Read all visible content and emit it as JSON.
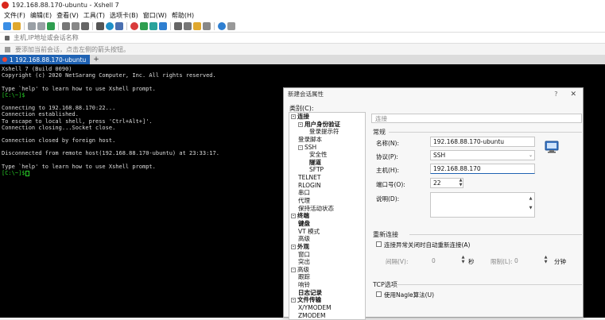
{
  "window": {
    "title": "192.168.88.170-ubuntu - Xshell 7"
  },
  "menu": [
    "文件(F)",
    "编辑(E)",
    "查看(V)",
    "工具(T)",
    "选项卡(B)",
    "窗口(W)",
    "帮助(H)"
  ],
  "address": {
    "placeholder": "主机,IP地址或会话名称"
  },
  "hint": {
    "text": "要添加当前会话，点击左侧的箭头按钮。"
  },
  "tab": {
    "label": "1 192.168.88.170-ubuntu",
    "add": "+"
  },
  "terminal": {
    "lines": [
      "Xshell 7 (Build 0090)",
      "Copyright (c) 2020 NetSarang Computer, Inc. All rights reserved.",
      "",
      "Type `help' to learn how to use Xshell prompt.",
      "[C:\\~]$",
      "",
      "Connecting to 192.168.88.170:22...",
      "Connection established.",
      "To escape to local shell, press 'Ctrl+Alt+]'.",
      "Connection closing...Socket close.",
      "",
      "Connection closed by foreign host.",
      "",
      "Disconnected from remote host(192.168.88.170-ubuntu) at 23:33:17.",
      "",
      "Type `help' to learn how to use Xshell prompt.",
      "[C:\\~]$"
    ]
  },
  "dialog": {
    "title": "新建会话属性",
    "help": "?",
    "close": "✕",
    "category_label": "类别(C):",
    "tree": [
      {
        "label": "连接",
        "level": "l0",
        "toggle": "-"
      },
      {
        "label": "用户身份验证",
        "level": "l1b",
        "toggle": "-"
      },
      {
        "label": "登录提示符",
        "level": "l2",
        "toggle": ""
      },
      {
        "label": "登录脚本",
        "level": "l1",
        "toggle": ""
      },
      {
        "label": "SSH",
        "level": "l1",
        "toggle": "-"
      },
      {
        "label": "安全性",
        "level": "l2",
        "toggle": ""
      },
      {
        "label": "隧道",
        "level": "l2b",
        "toggle": ""
      },
      {
        "label": "SFTP",
        "level": "l2",
        "toggle": ""
      },
      {
        "label": "TELNET",
        "level": "l1",
        "toggle": ""
      },
      {
        "label": "RLOGIN",
        "level": "l1",
        "toggle": ""
      },
      {
        "label": "串口",
        "level": "l1",
        "toggle": ""
      },
      {
        "label": "代理",
        "level": "l1",
        "toggle": ""
      },
      {
        "label": "保持活动状态",
        "level": "l1",
        "toggle": ""
      },
      {
        "label": "终端",
        "level": "l0",
        "toggle": "-"
      },
      {
        "label": "键盘",
        "level": "l1b",
        "toggle": ""
      },
      {
        "label": "VT 模式",
        "level": "l1",
        "toggle": ""
      },
      {
        "label": "高级",
        "level": "l1",
        "toggle": ""
      },
      {
        "label": "外观",
        "level": "l0",
        "toggle": "-"
      },
      {
        "label": "窗口",
        "level": "l1",
        "toggle": ""
      },
      {
        "label": "突出",
        "level": "l1",
        "toggle": ""
      },
      {
        "label": "高级",
        "level": "l0n",
        "toggle": "-"
      },
      {
        "label": "跟踪",
        "level": "l1",
        "toggle": ""
      },
      {
        "label": "响铃",
        "level": "l1",
        "toggle": ""
      },
      {
        "label": "日志记录",
        "level": "l1b",
        "toggle": ""
      },
      {
        "label": "文件传输",
        "level": "l0",
        "toggle": "-"
      },
      {
        "label": "X/YMODEM",
        "level": "l1",
        "toggle": ""
      },
      {
        "label": "ZMODEM",
        "level": "l1",
        "toggle": ""
      }
    ],
    "section_header": "连接",
    "general": {
      "title": "常规",
      "name_label": "名称(N):",
      "name_value": "192.168.88.170-ubuntu",
      "protocol_label": "协议(P):",
      "protocol_value": "SSH",
      "host_label": "主机(H):",
      "host_value": "192.168.88.170",
      "port_label": "端口号(O):",
      "port_value": "22",
      "desc_label": "说明(D):",
      "desc_value": ""
    },
    "reconnect": {
      "title": "重新连接",
      "checkbox_label": "连接异常关闭时自动重新连接(A)",
      "interval_label": "间隔(V):",
      "interval_value": "0",
      "interval_unit": "秒",
      "limit_label": "限制(L):",
      "limit_value": "0",
      "limit_unit": "分钟"
    },
    "tcp": {
      "title": "TCP选项",
      "nagle_label": "使用Nagle算法(U)"
    }
  }
}
